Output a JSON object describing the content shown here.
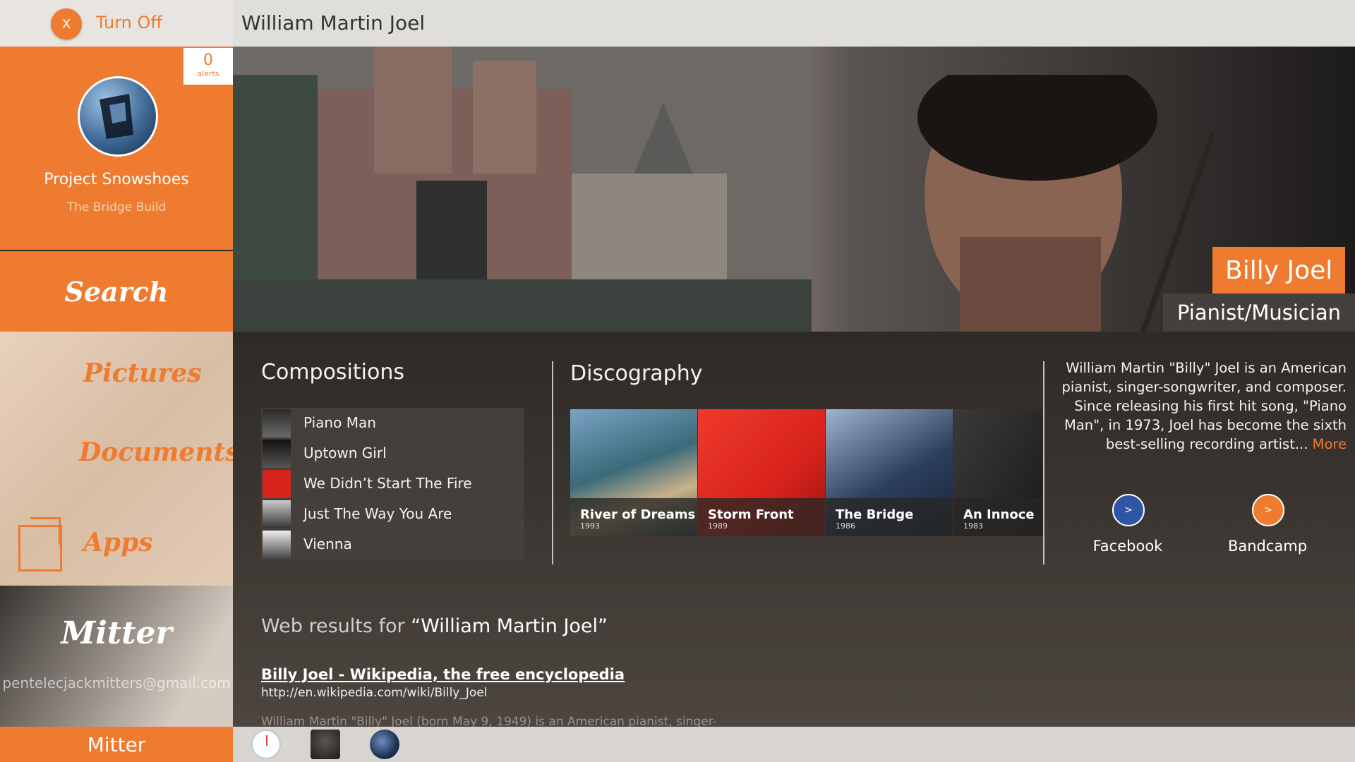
{
  "top": {
    "turnoff_icon": "X",
    "turnoff_label": "Turn Off",
    "query": "William Martin Joel"
  },
  "sidebar": {
    "alerts_count": "0",
    "alerts_label": "alerts",
    "project_name": "Project Snowshoes",
    "project_sub": "The Bridge Build",
    "nav": {
      "search": "Search",
      "pictures": "Pictures",
      "documents": "Documents",
      "apps": "Apps"
    },
    "user": {
      "name": "Mitter",
      "email": "pentelecjackmitters@gmail.com",
      "button": "Mitter"
    }
  },
  "hero": {
    "name": "Billy Joel",
    "role": "Pianist/Musician"
  },
  "compositions": {
    "title": "Compositions",
    "items": [
      "Piano Man",
      "Uptown Girl",
      "We Didn’t Start The Fire",
      "Just The Way You Are",
      "Vienna"
    ]
  },
  "discography": {
    "title": "Discography",
    "albums": [
      {
        "title": "River of Dreams",
        "year": "1993",
        "color": "#3b6a7a"
      },
      {
        "title": "Storm Front",
        "year": "1989",
        "color": "#d8231c"
      },
      {
        "title": "The Bridge",
        "year": "1986",
        "color": "#2c3f5c"
      },
      {
        "title": "An Innoce",
        "year": "1983",
        "color": "#1b1b1b"
      }
    ]
  },
  "bio": {
    "text": "William Martin \"Billy\" Joel is an American pianist, singer-songwriter, and composer. Since releasing his first hit song, \"Piano Man\", in 1973, Joel has become the sixth best-selling recording artist...",
    "more": "More"
  },
  "social": {
    "facebook_label": "Facebook",
    "facebook_icon": ">",
    "bandcamp_label": "Bandcamp",
    "bandcamp_icon": ">"
  },
  "web": {
    "heading_prefix": "Web results for ",
    "heading_query": "“William Martin Joel”",
    "result": {
      "title": "Billy Joel - Wikipedia, the free encyclopedia",
      "url": "http://en.wikipedia.com/wiki/Billy_Joel",
      "snippet": "William Martin \"Billy\" Joel (born May 9, 1949) is an American pianist, singer-"
    }
  },
  "colors": {
    "accent": "#ee7b2f",
    "facebook": "#2f55a4"
  }
}
